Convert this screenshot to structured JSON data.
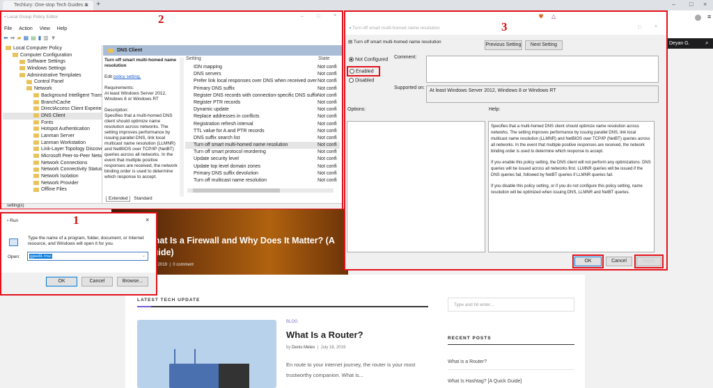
{
  "browser": {
    "tab_title": "Techlury: One-stop Tech Guides &",
    "user": "Deyan G."
  },
  "annotations": {
    "run": "1",
    "gpe": "2",
    "dialog": "3"
  },
  "gpe": {
    "title": "Local Group Policy Editor",
    "menu": [
      "File",
      "Action",
      "View",
      "Help"
    ],
    "tree": [
      "Local Computer Policy",
      "Computer Configuration",
      "Software Settings",
      "Windows Settings",
      "Administrative Templates",
      "Control Panel",
      "Network",
      "Background Intelligent Trans",
      "BranchCache",
      "DirectAccess Client Experien",
      "DNS Client",
      "Fonts",
      "Hotspot Authentication",
      "Lanman Server",
      "Lanman Workstation",
      "Link-Layer Topology Discove",
      "Microsoft Peer-to-Peer Netw",
      "Network Connections",
      "Network Connectivity Status",
      "Network Isolation",
      "Network Provider",
      "Offline Files"
    ],
    "header": "DNS Client",
    "desc_title": "Turn off smart multi-homed name resolution",
    "edit_prefix": "Edit ",
    "edit_link": "policy setting.",
    "requirements": "Requirements:",
    "req_text": "At least Windows Server 2012, Windows 8 or Windows RT",
    "description": "Description:",
    "desc_text": "Specifies that a multi-homed DNS client should optimize name resolution across networks.  The setting improves performance by issuing parallel DNS, link local multicast name resolution (LLMNR) and NetBIOS over TCP/IP (NetBT) queries across all networks. In the event that multiple positive responses are received, the network binding order is used to determine which response to accept.",
    "col_setting": "Setting",
    "col_state": "State",
    "settings": [
      {
        "name": "IDN mapping",
        "state": "Not confi"
      },
      {
        "name": "DNS servers",
        "state": "Not confi"
      },
      {
        "name": "Prefer link local responses over DNS when received over a n...",
        "state": "Not confi"
      },
      {
        "name": "Primary DNS suffix",
        "state": "Not confi"
      },
      {
        "name": "Register DNS records with connection-specific DNS suffix",
        "state": "Not confi"
      },
      {
        "name": "Register PTR records",
        "state": "Not confi"
      },
      {
        "name": "Dynamic update",
        "state": "Not confi"
      },
      {
        "name": "Replace addresses in conflicts",
        "state": "Not confi"
      },
      {
        "name": "Registration refresh interval",
        "state": "Not confi"
      },
      {
        "name": "TTL value for A and PTR records",
        "state": "Not confi"
      },
      {
        "name": "DNS suffix search list",
        "state": "Not confi"
      },
      {
        "name": "Turn off smart multi-homed name resolution",
        "state": "Not confi"
      },
      {
        "name": "Turn off smart protocol reordering",
        "state": "Not confi"
      },
      {
        "name": "Update security level",
        "state": "Not confi"
      },
      {
        "name": "Update top level domain zones",
        "state": "Not confi"
      },
      {
        "name": "Primary DNS suffix devolution",
        "state": "Not confi"
      },
      {
        "name": "Turn off multicast name resolution",
        "state": "Not confi"
      }
    ],
    "tabs": [
      "Extended",
      "Standard"
    ],
    "status": "setting(s)"
  },
  "dialog": {
    "title": "Turn off smart multi-homed name resolution",
    "setting_name": "Turn off smart multi-homed name resolution",
    "prev": "Previous Setting",
    "next": "Next Setting",
    "not_configured": "Not Configured",
    "enabled": "Enabled",
    "disabled": "Disabled",
    "comment": "Comment:",
    "supported_on": "Supported on:",
    "supported_text": "At least Windows Server 2012, Windows 8 or Windows RT",
    "options": "Options:",
    "help": "Help:",
    "help_text": [
      "Specifies that a multi-homed DNS client should optimize name resolution across networks.  The setting improves performance by issuing parallel DNS, link local multicast name resolution (LLMNR) and NetBIOS over TCP/IP (NetBT) queries across all networks. In the event that multiple positive responses are received, the network binding order is used to determine which response to accept.",
      "If you enable this policy setting, the DNS client will not perform any optimizations. DNS queries will be issued across all networks first. LLMNR queries will be issued if the DNS queries fail, followed by NetBT queries if LLMNR queries fail.",
      "If you disable this policy setting, or if you do not configure this policy setting, name resolution will be optimized when issuing DNS, LLMNR and NetBT queries."
    ],
    "ok": "OK",
    "cancel": "Cancel",
    "apply": "Apply"
  },
  "run": {
    "title": "Run",
    "text": "Type the name of a program, folder, document, or Internet resource, and Windows will open it for you.",
    "open_label": "Open:",
    "value": "gpedit.msc",
    "ok": "OK",
    "cancel": "Cancel",
    "browse": "Browse..."
  },
  "site": {
    "hero_title": "What Is a Firewall and Why Does It Matter? (A Guide)",
    "hero_date": "7, 2019",
    "hero_comments": "0 comment",
    "section": "LATEST TECH UPDATE",
    "post": {
      "category": "BLOG",
      "title": "What Is a Router?",
      "by": "by",
      "author": "Denis Metev",
      "date": "July 18, 2019",
      "excerpt": "En route to your internet journey, the router is your most trustworthy companion. What is..."
    },
    "search_placeholder": "Type and hit enter...",
    "recent_title": "RECENT POSTS",
    "recent": [
      "What is a Router?",
      "What Is Hashtag? [A Quick Guide]"
    ]
  }
}
